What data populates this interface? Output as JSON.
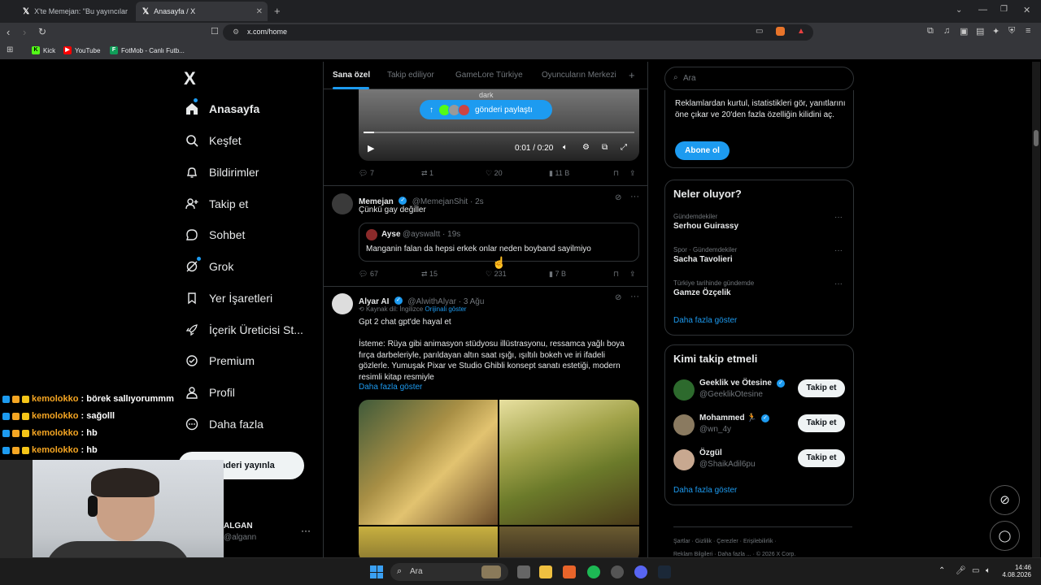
{
  "browser": {
    "tabs": [
      {
        "title": "X'te Memejan: \"Bu yayıncılar neden l",
        "active": false
      },
      {
        "title": "Anasayfa / X",
        "active": true
      }
    ],
    "url": "x.com/home",
    "bookmarks": [
      "Kick",
      "YouTube",
      "FotMob - Canlı Futb..."
    ]
  },
  "nav": {
    "logo": "X",
    "items": [
      {
        "label": "Anasayfa",
        "icon": "home-icon"
      },
      {
        "label": "Keşfet",
        "icon": "search-icon"
      },
      {
        "label": "Bildirimler",
        "icon": "bell-icon"
      },
      {
        "label": "Takip et",
        "icon": "follow-icon"
      },
      {
        "label": "Sohbet",
        "icon": "chat-icon"
      },
      {
        "label": "Grok",
        "icon": "grok-icon"
      },
      {
        "label": "Yer İşaretleri",
        "icon": "bookmark-icon"
      },
      {
        "label": "İçerik Üreticisi St...",
        "icon": "rocket-icon"
      },
      {
        "label": "Premium",
        "icon": "premium-icon"
      },
      {
        "label": "Profil",
        "icon": "profile-icon"
      },
      {
        "label": "Daha fazla",
        "icon": "more-icon"
      }
    ],
    "post_button": "Gönderi yayınla",
    "account_name": "ALGAN",
    "account_handle": "@algann"
  },
  "feed": {
    "tabs": [
      "Sana özel",
      "Takip ediliyor",
      "GameLore Türkiye",
      "Oyuncuların Merkezi"
    ],
    "video": {
      "share_pill": "gönderi paylaştı",
      "time": "0:01 / 0:20",
      "watermark": "dark"
    },
    "tweet0_stats": {
      "replies": "7",
      "reposts": "1",
      "likes": "20",
      "views": "11 B"
    },
    "tweet1": {
      "name": "Memejan",
      "handle": "@MemejanShit · 2s",
      "text": "Çünkü gay değiller",
      "quote_name": "Ayse",
      "quote_handle": "@ayswaltt · 19s",
      "quote_text": "Manganin falan da hepsi erkek onlar neden boyband sayilmiyo",
      "stats": {
        "replies": "67",
        "reposts": "15",
        "likes": "231",
        "views": "7 B"
      }
    },
    "tweet2": {
      "name": "Alyar AI",
      "handle": "@AlwithAlyar · 3 Ağu",
      "source_lang": "Kaynak dil: İngilizce",
      "show_original": "Orijinali göster",
      "line1": "Gpt 2 chat gpt'de hayal et",
      "line2": "İsteme: Rüya gibi animasyon stüdyosu illüstrasyonu, ressamca yağlı boya fırça darbeleriyle, parıldayan altın saat ışığı, ışıltılı bokeh ve iri ifadeli gözlerle. Yumuşak Pixar ve Studio Ghibli konsept sanatı estetiği, modern resimli kitap resmiyle",
      "show_more": "Daha fazla göster"
    }
  },
  "right": {
    "search_placeholder": "Ara",
    "premium_text": "Reklamlardan kurtul, istatistikleri gör, yanıtlarını öne çıkar ve 20'den fazla özelliğin kilidini aç.",
    "subscribe": "Abone ol",
    "trends_title": "Neler oluyor?",
    "trends": [
      {
        "category": "Gündemdekiler",
        "name": "Serhou Guirassy"
      },
      {
        "category": "Spor · Gündemdekiler",
        "name": "Sacha Tavolieri"
      },
      {
        "category": "Türkiye tarihinde gündemde",
        "name": "Gamze Özçelik"
      }
    ],
    "show_more": "Daha fazla göster",
    "who_title": "Kimi takip etmeli",
    "who": [
      {
        "name": "Geeklik ve Ötesine",
        "handle": "@GeeklikOtesine"
      },
      {
        "name": "Mohammed 🏃",
        "handle": "@wn_4y"
      },
      {
        "name": "Özgül",
        "handle": "@ShaikAdil6pu"
      }
    ],
    "follow": "Takip et",
    "footer1": "Şartlar · Gizlilik · Çerezler · Erişilebilirlik ·",
    "footer2": "Reklam Bilgileri · Daha fazla ... · © 2026 X Corp."
  },
  "chat": [
    {
      "user": "kemolokko",
      "msg": ": börek sallıyorummm"
    },
    {
      "user": "kemolokko",
      "msg": ": sağolll"
    },
    {
      "user": "kemolokko",
      "msg": ": hb"
    },
    {
      "user": "kemolokko",
      "msg": ": hb"
    }
  ],
  "taskbar": {
    "search": "Ara",
    "time": "14:46",
    "date": "4.08.2026"
  }
}
